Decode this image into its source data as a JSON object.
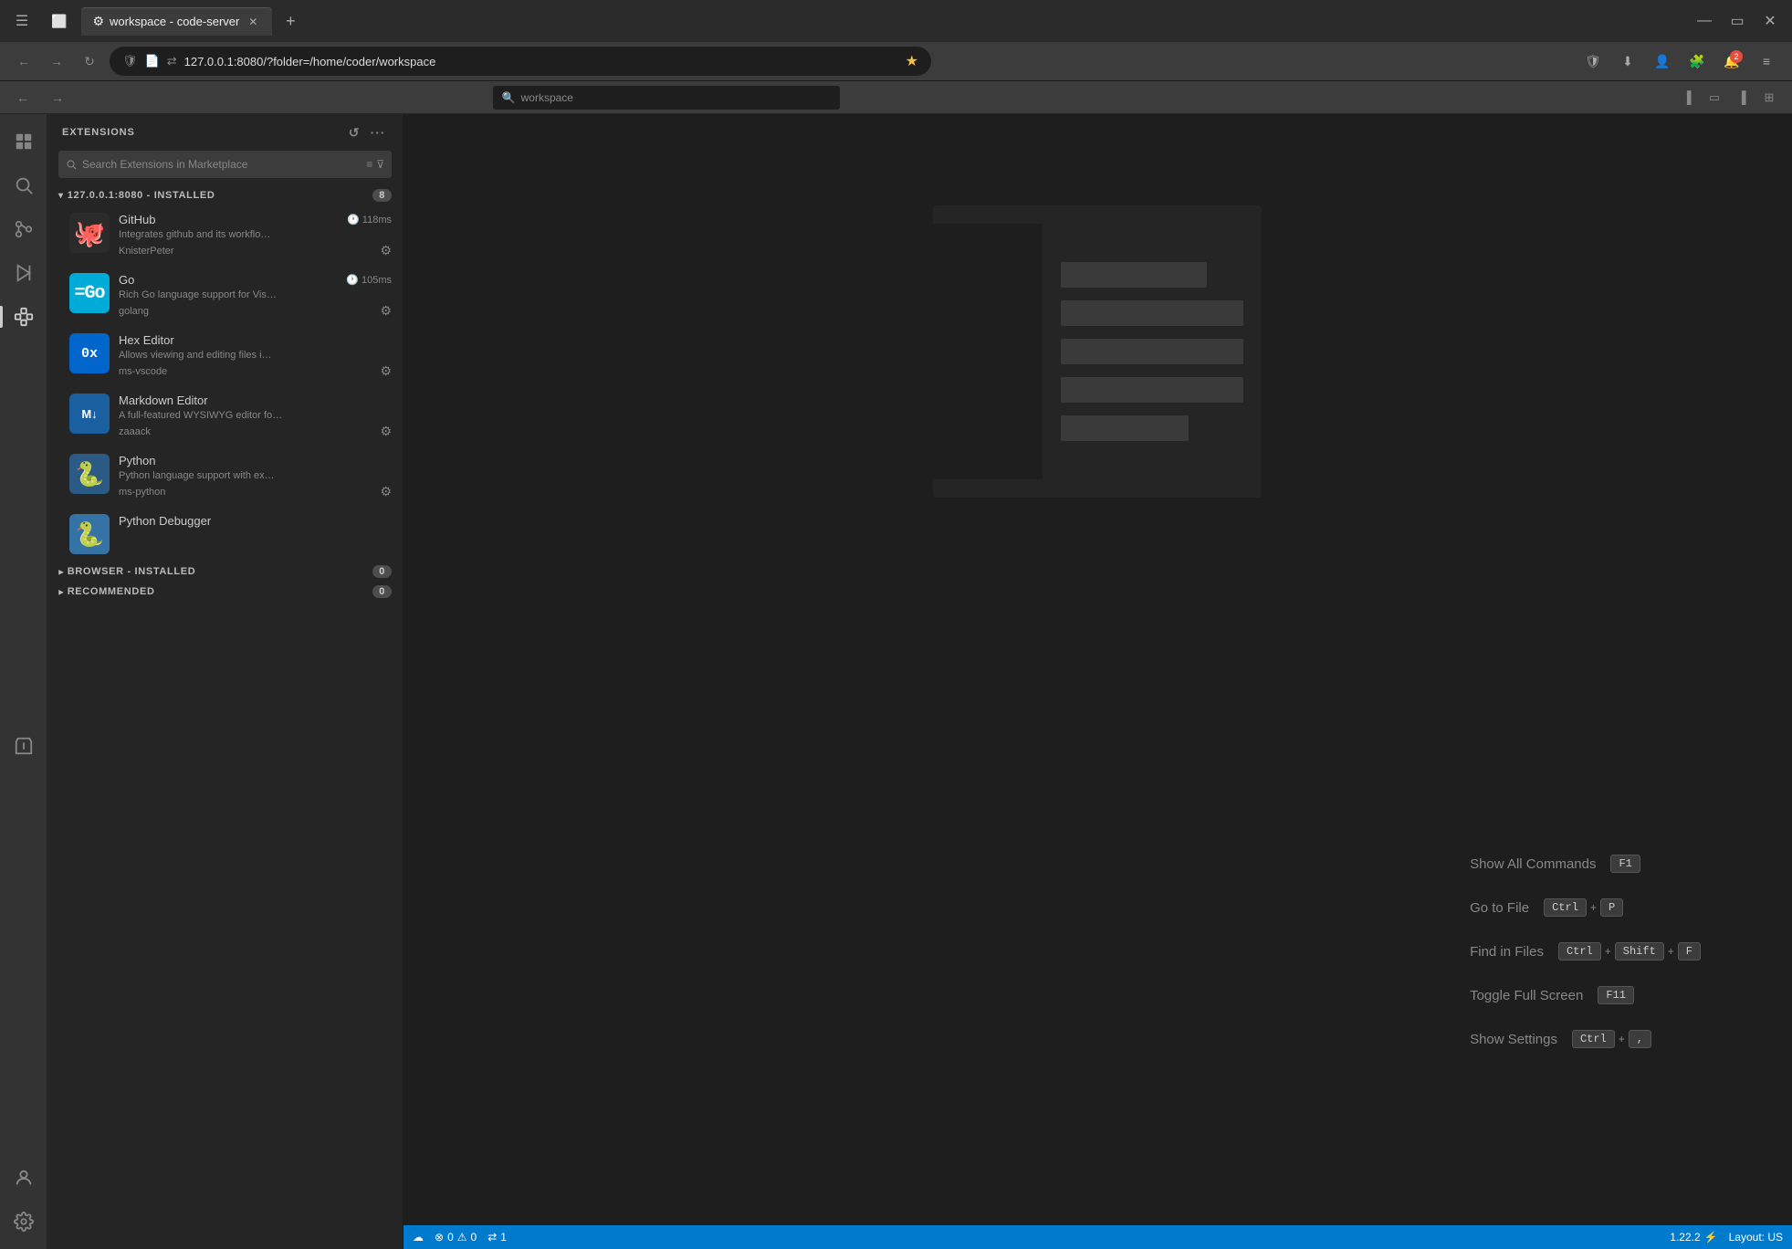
{
  "browser": {
    "tabs": [
      {
        "label": "workspace - code-server",
        "active": true,
        "favicon": "⚙"
      }
    ],
    "url": "127.0.0.1:8080/?folder=/home/coder/workspace",
    "new_tab_label": "+",
    "search_placeholder": "workspace"
  },
  "vscode": {
    "topbar": {
      "back_label": "←",
      "forward_label": "→",
      "search_text": "workspace"
    },
    "sidebar": {
      "title": "EXTENSIONS",
      "search_placeholder": "Search Extensions in Marketplace",
      "sections": [
        {
          "label": "127.0.0.1:8080 - INSTALLED",
          "count": "8",
          "expanded": true
        },
        {
          "label": "BROWSER - INSTALLED",
          "count": "0",
          "expanded": false
        },
        {
          "label": "RECOMMENDED",
          "count": "0",
          "expanded": false
        }
      ],
      "extensions": [
        {
          "name": "GitHub",
          "time": "118ms",
          "description": "Integrates github and its workflo…",
          "author": "KnisterPeter",
          "icon_type": "github",
          "icon_color": "#2b2b2b",
          "icon_text": "🐙"
        },
        {
          "name": "Go",
          "time": "105ms",
          "description": "Rich Go language support for Vis…",
          "author": "golang",
          "icon_type": "go",
          "icon_color": "#00acd7",
          "icon_text": "Go"
        },
        {
          "name": "Hex Editor",
          "time": "",
          "description": "Allows viewing and editing files i…",
          "author": "ms-vscode",
          "icon_type": "hex",
          "icon_color": "#0066cc",
          "icon_text": "0x"
        },
        {
          "name": "Markdown Editor",
          "time": "",
          "description": "A full-featured WYSIWYG editor fo…",
          "author": "zaaack",
          "icon_type": "md",
          "icon_color": "#1a6ee0",
          "icon_text": "M↓"
        },
        {
          "name": "Python",
          "time": "",
          "description": "Python language support with ex…",
          "author": "ms-python",
          "icon_type": "python",
          "icon_color": "#2b5b84",
          "icon_text": "🐍"
        },
        {
          "name": "Python Debugger",
          "time": "",
          "description": "",
          "author": "",
          "icon_type": "pydebug",
          "icon_color": "#3572a5",
          "icon_text": "🐍"
        }
      ]
    },
    "welcome": {
      "commands": [
        {
          "label": "Show All Commands",
          "keys": [
            "F1"
          ],
          "key_separator": ""
        },
        {
          "label": "Go to File",
          "keys": [
            "Ctrl",
            "+",
            "P"
          ],
          "key_separator": "+"
        },
        {
          "label": "Find in Files",
          "keys": [
            "Ctrl",
            "+",
            "Shift",
            "+",
            "F"
          ],
          "key_separator": "+"
        },
        {
          "label": "Toggle Full Screen",
          "keys": [
            "F11"
          ],
          "key_separator": ""
        },
        {
          "label": "Show Settings",
          "keys": [
            "Ctrl",
            "+",
            ","
          ],
          "key_separator": "+"
        }
      ]
    },
    "statusbar": {
      "left": [
        {
          "icon": "☁",
          "text": ""
        },
        {
          "icon": "⚠",
          "text": "0"
        },
        {
          "icon": "△",
          "text": "0"
        },
        {
          "icon": "⇄",
          "text": "1"
        }
      ],
      "right": [
        {
          "text": "1.22.2",
          "icon": "⚡"
        },
        {
          "text": "Layout: US",
          "icon": ""
        }
      ]
    }
  }
}
